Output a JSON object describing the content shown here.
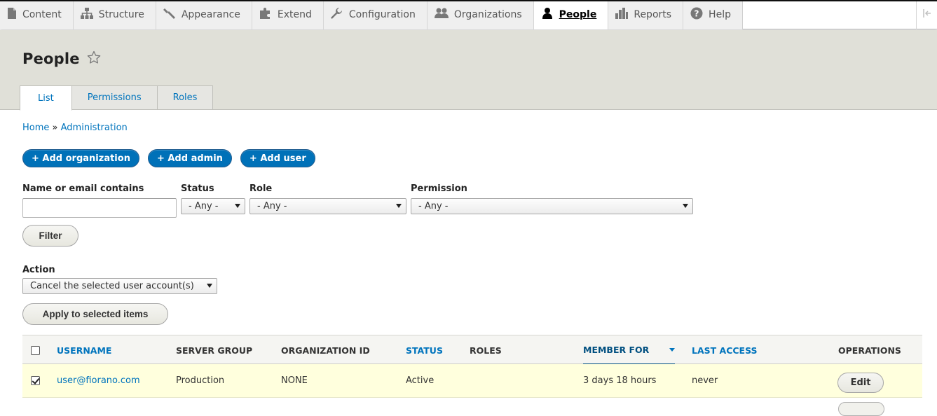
{
  "toolbar": {
    "items": [
      {
        "label": "Content",
        "icon": "content-icon"
      },
      {
        "label": "Structure",
        "icon": "structure-icon"
      },
      {
        "label": "Appearance",
        "icon": "appearance-icon"
      },
      {
        "label": "Extend",
        "icon": "extend-icon"
      },
      {
        "label": "Configuration",
        "icon": "configuration-icon"
      },
      {
        "label": "Organizations",
        "icon": "organizations-icon"
      },
      {
        "label": "People",
        "icon": "people-icon",
        "active": true
      },
      {
        "label": "Reports",
        "icon": "reports-icon"
      },
      {
        "label": "Help",
        "icon": "help-icon"
      }
    ]
  },
  "page": {
    "title": "People",
    "tabs": [
      "List",
      "Permissions",
      "Roles"
    ],
    "active_tab": "List"
  },
  "breadcrumb": {
    "home": "Home",
    "separator": "»",
    "admin": "Administration"
  },
  "actions": {
    "add_organization": "+ Add organization",
    "add_admin": "+ Add admin",
    "add_user": "+ Add user"
  },
  "filters": {
    "name_label": "Name or email contains",
    "name_value": "",
    "status_label": "Status",
    "status_value": "- Any -",
    "role_label": "Role",
    "role_value": "- Any -",
    "permission_label": "Permission",
    "permission_value": "- Any -",
    "filter_button": "Filter"
  },
  "bulk": {
    "action_label": "Action",
    "action_value": "Cancel the selected user account(s)",
    "apply_button": "Apply to selected items"
  },
  "table": {
    "headers": {
      "username": "Username",
      "server_group": "Server group",
      "organization_id": "Organization ID",
      "status": "Status",
      "roles": "Roles",
      "member_for": "Member for",
      "last_access": "Last access",
      "operations": "Operations"
    },
    "rows": [
      {
        "checked": true,
        "username": "user@fiorano.com",
        "server_group": "Production",
        "organization_id": "NONE",
        "status": "Active",
        "roles": "",
        "member_for": "3 days 18 hours",
        "last_access": "never",
        "operation": "Edit"
      }
    ]
  },
  "colors": {
    "link": "#0074bd",
    "primary_button": "#0071b8",
    "selected_row": "#ffffdd"
  }
}
